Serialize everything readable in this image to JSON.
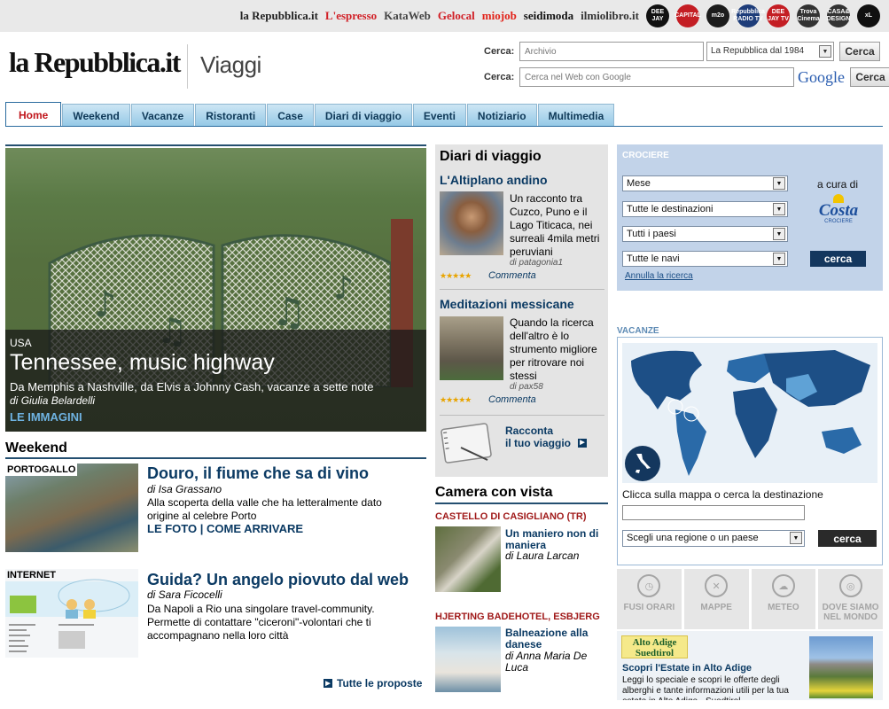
{
  "topbar": {
    "brands": [
      {
        "label": "la Repubblica.it",
        "color": "#222"
      },
      {
        "label": "L'espresso",
        "color": "#d12027"
      },
      {
        "label": "KataWeb",
        "color": "#444"
      },
      {
        "label": "Gelocal",
        "color": "#d12027"
      },
      {
        "label": "miojob",
        "color": "#e2231a"
      },
      {
        "label": "seidimoda",
        "color": "#111"
      },
      {
        "label": "ilmiolibro.it",
        "color": "#333"
      }
    ],
    "radios": [
      {
        "label": "DEE JAY",
        "color": "#111"
      },
      {
        "label": "CAPITAL",
        "color": "#c41e24"
      },
      {
        "label": "m2o",
        "color": "#1c1c1c"
      },
      {
        "label": "Repubblica RADIO TV",
        "color": "#1e3d7a"
      },
      {
        "label": "DEE JAY TV",
        "color": "#c41e24"
      },
      {
        "label": "Trova Cinema",
        "color": "#333"
      },
      {
        "label": "CASA& DESIGN",
        "color": "#333"
      },
      {
        "label": "xL",
        "color": "#111"
      }
    ]
  },
  "header": {
    "logo": "la Repubblica.it",
    "section": "Viaggi"
  },
  "search": {
    "label": "Cerca:",
    "archive_placeholder": "Archivio",
    "archive_select": "La Repubblica dal 1984",
    "button": "Cerca",
    "web_placeholder": "Cerca nel Web con Google",
    "google": "Google"
  },
  "nav": {
    "tabs": [
      "Home",
      "Weekend",
      "Vacanze",
      "Ristoranti",
      "Case",
      "Diari di viaggio",
      "Eventi",
      "Notiziario",
      "Multimedia"
    ]
  },
  "hero": {
    "country": "USA",
    "title": "Tennessee, music highway",
    "subtitle": "Da Memphis a Nashville, da Elvis a Johnny Cash, vacanze a sette note",
    "author_prefix": "di ",
    "author": "Giulia Belardelli",
    "link": "LE IMMAGINI"
  },
  "weekend": {
    "heading": "Weekend",
    "items": [
      {
        "kicker": "PORTOGALLO",
        "title": "Douro, il fiume che sa di vino",
        "author": "di Isa Grassano",
        "text": "Alla scoperta della valle che ha letteralmente dato origine al celebre Porto",
        "link1": "LE FOTO",
        "sep": "|",
        "link2": "COME ARRIVARE"
      },
      {
        "kicker": "INTERNET",
        "title": "Guida? Un angelo piovuto dal web",
        "author": "di Sara Ficocelli",
        "text": "Da Napoli a Rio una singolare travel-community. Permette di contattare \"ciceroni\"-volontari che ti accompagnano nella loro città"
      }
    ],
    "more": "Tutte le proposte"
  },
  "diari": {
    "heading": "Diari di viaggio",
    "items": [
      {
        "title": "L'Altiplano andino",
        "text": "Un racconto tra Cuzco, Puno e il Lago Titicaca, nei surreali 4mila metri peruviani",
        "by": "di patagonia1",
        "stars": "★★★★★",
        "comment": "Commenta"
      },
      {
        "title": "Meditazioni messicane",
        "text": "Quando la ricerca dell'altro è lo strumento migliore per ritrovare noi stessi",
        "by": "di pax58",
        "stars": "★★★★★",
        "comment": "Commenta"
      }
    ],
    "racconta_line1": "Racconta",
    "racconta_line2": "il tuo viaggio"
  },
  "camera": {
    "heading": "Camera con vista",
    "items": [
      {
        "place": "CASTELLO DI CASIGLIANO (TR)",
        "title": "Un maniero non di maniera",
        "author": "di Laura Larcan"
      },
      {
        "place": "HJERTING BADEHOTEL, ESBJERG",
        "title": "Balneazione alla danese",
        "author": "di Anna Maria De Luca"
      }
    ]
  },
  "crociere": {
    "label": "CROCIERE",
    "selects": [
      "Mese",
      "Tutte le destinazioni",
      "Tutti i paesi",
      "Tutte le navi"
    ],
    "cura": "a cura di",
    "brand": "Costa",
    "brand_sub": "CROCIERE",
    "button": "cerca",
    "reset": "Annulla la ricerca"
  },
  "vacanze": {
    "label": "VACANZE",
    "hint": "Clicca sulla mappa o cerca la destinazione",
    "select": "Scegli una regione o un paese",
    "button": "cerca"
  },
  "tools": [
    {
      "label": "FUSI ORARI",
      "icon": "clock-icon",
      "glyph": "◷"
    },
    {
      "label": "MAPPE",
      "icon": "map-icon",
      "glyph": "✕"
    },
    {
      "label": "METEO",
      "icon": "cloud-icon",
      "glyph": "☁"
    },
    {
      "label": "DOVE SIAMO NEL MONDO",
      "icon": "globe-icon",
      "glyph": "◎"
    }
  ],
  "alto": {
    "badge_line1": "Alto Adige",
    "badge_line2": "Suedtirol",
    "title": "Scopri l'Estate in Alto Adige",
    "text": "Leggi lo speciale e scopri le offerte degli alberghi e tante informazioni utili per la tua estate in Alto Adige - Suedtirol"
  }
}
